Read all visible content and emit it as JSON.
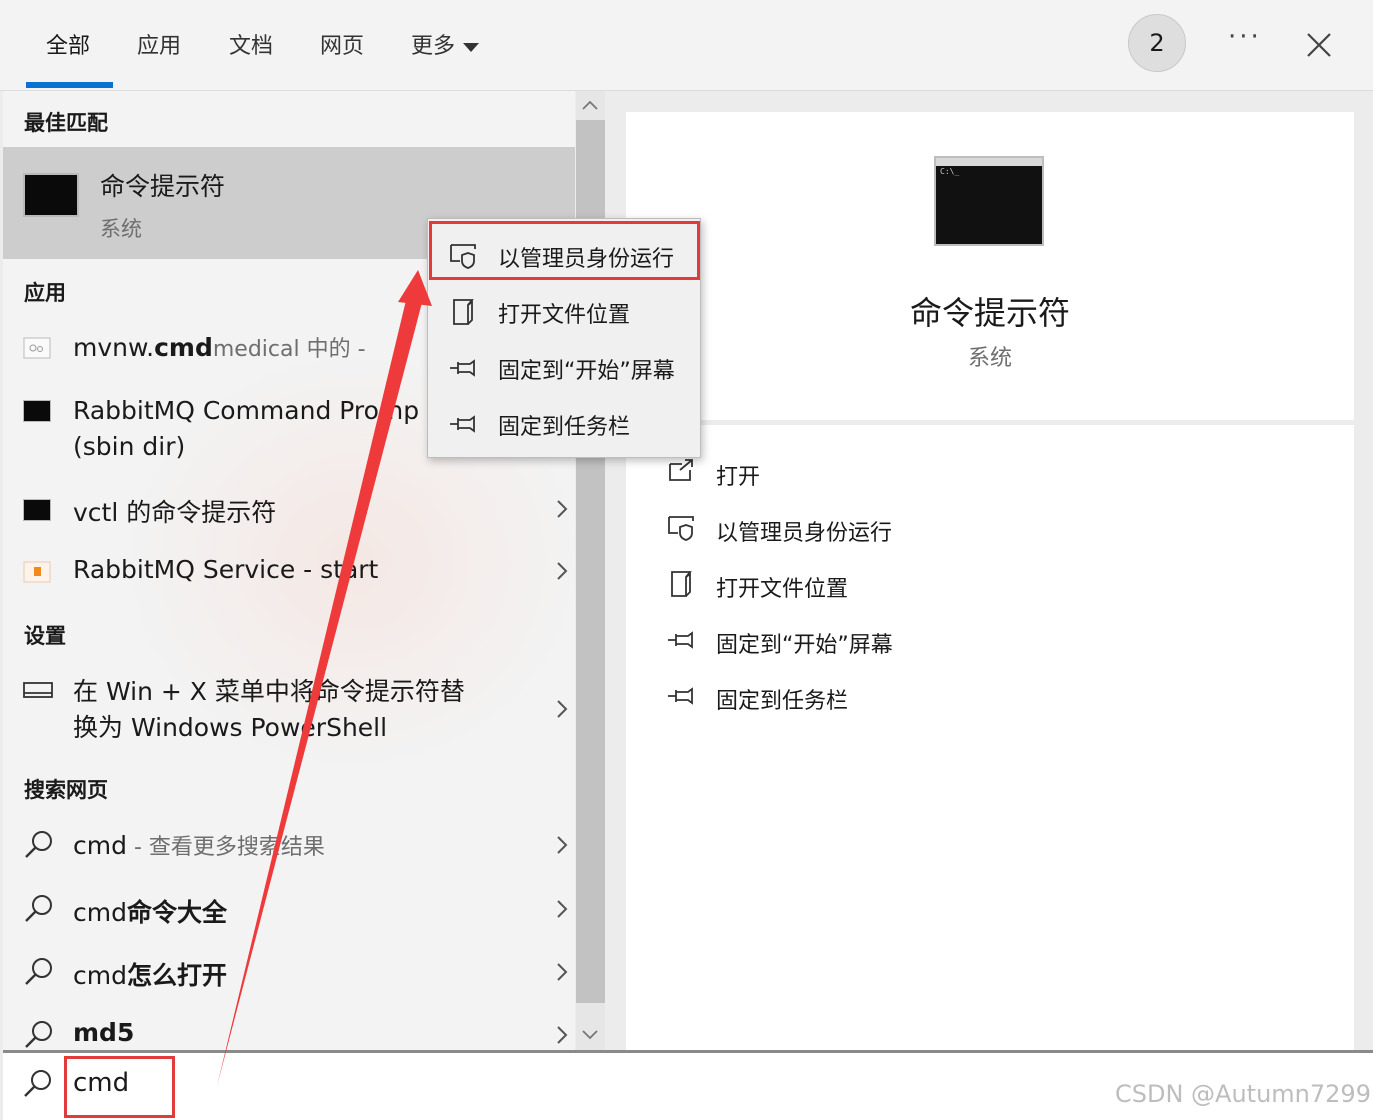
{
  "tabs": [
    {
      "label": "全部"
    },
    {
      "label": "应用"
    },
    {
      "label": "文档"
    },
    {
      "label": "网页"
    },
    {
      "label": "更多"
    }
  ],
  "badge_count": "2",
  "more_dots": "···",
  "accent_color": "#0a72d1",
  "annotation_color": "#e23b3b",
  "left": {
    "best_match_header": "最佳匹配",
    "best_match": {
      "title": "命令提示符",
      "subtitle": "系统"
    },
    "apps_header": "应用",
    "apps": [
      {
        "pre": "mvnw.",
        "bold": "cmd",
        "gray": "medical 中的 -"
      },
      {
        "line1": "RabbitMQ Command Promp",
        "line2": "(sbin dir)"
      },
      {
        "text": "vctl 的命令提示符"
      },
      {
        "text": "RabbitMQ Service - start"
      }
    ],
    "settings_header": "设置",
    "settings": [
      {
        "line1": "在 Win + X 菜单中将命令提示符替",
        "line2": "换为 Windows PowerShell"
      }
    ],
    "web_header": "搜索网页",
    "web": [
      {
        "pre": "cmd",
        "gray": " - 查看更多搜索结果",
        "bold": ""
      },
      {
        "pre": "cmd",
        "bold": "命令大全",
        "gray": ""
      },
      {
        "pre": "cmd",
        "bold": "怎么打开",
        "gray": ""
      },
      {
        "pre": "",
        "bold": "md5",
        "gray": ""
      }
    ]
  },
  "context_menu": [
    {
      "label": "以管理员身份运行",
      "icon": "shield-icon"
    },
    {
      "label": "打开文件位置",
      "icon": "folder-location-icon"
    },
    {
      "label": "固定到“开始”屏幕",
      "icon": "pin-icon"
    },
    {
      "label": "固定到任务栏",
      "icon": "pin-icon"
    }
  ],
  "right": {
    "title": "命令提示符",
    "subtitle": "系统",
    "cmd_prompt": "C:\\_",
    "actions": [
      {
        "label": "打开",
        "icon": "open-icon"
      },
      {
        "label": "以管理员身份运行",
        "icon": "shield-icon"
      },
      {
        "label": "打开文件位置",
        "icon": "folder-location-icon"
      },
      {
        "label": "固定到“开始”屏幕",
        "icon": "pin-icon"
      },
      {
        "label": "固定到任务栏",
        "icon": "pin-icon"
      }
    ]
  },
  "search": {
    "value": "cmd"
  },
  "watermark": "CSDN @Autumn7299"
}
